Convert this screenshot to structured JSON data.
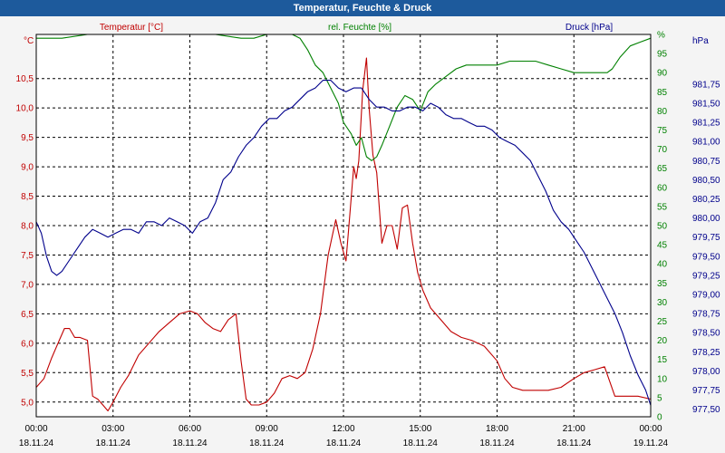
{
  "window": {
    "title": "Temperatur, Feuchte & Druck"
  },
  "chart_data": {
    "type": "line",
    "title": "Temperatur, Feuchte & Druck",
    "grid": true,
    "x_ticks": [
      {
        "h": 0,
        "time": "00:00",
        "date": "18.11.24"
      },
      {
        "h": 3,
        "time": "03:00",
        "date": "18.11.24"
      },
      {
        "h": 6,
        "time": "06:00",
        "date": "18.11.24"
      },
      {
        "h": 9,
        "time": "09:00",
        "date": "18.11.24"
      },
      {
        "h": 12,
        "time": "12:00",
        "date": "18.11.24"
      },
      {
        "h": 15,
        "time": "15:00",
        "date": "18.11.24"
      },
      {
        "h": 18,
        "time": "18:00",
        "date": "18.11.24"
      },
      {
        "h": 21,
        "time": "21:00",
        "date": "18.11.24"
      },
      {
        "h": 24,
        "time": "00:00",
        "date": "19.11.24"
      }
    ],
    "axes": {
      "temperature": {
        "label": "Temperatur [°C]",
        "unit": "°C",
        "color": "#c00000",
        "ylim": [
          4.75,
          11.25
        ],
        "ticks": [
          5.0,
          5.5,
          6.0,
          6.5,
          7.0,
          7.5,
          8.0,
          8.5,
          9.0,
          9.5,
          10.0,
          10.5
        ],
        "tick_labels": [
          "5,0",
          "5,5",
          "6,0",
          "6,5",
          "7,0",
          "7,5",
          "8,0",
          "8,5",
          "9,0",
          "9,5",
          "10,0",
          "10,5"
        ]
      },
      "humidity": {
        "label": "rel. Feuchte [%]",
        "unit": "%",
        "color": "#008000",
        "ylim": [
          0,
          100
        ],
        "ticks": [
          0,
          5,
          10,
          15,
          20,
          25,
          30,
          35,
          40,
          45,
          50,
          55,
          60,
          65,
          70,
          75,
          80,
          85,
          90,
          95,
          100
        ],
        "tick_labels": [
          "0",
          "5",
          "10",
          "15",
          "20",
          "25",
          "30",
          "35",
          "40",
          "45",
          "50",
          "55",
          "60",
          "65",
          "70",
          "75",
          "80",
          "85",
          "90",
          "95",
          "%"
        ]
      },
      "pressure": {
        "label": "Druck [hPa]",
        "unit": "hPa",
        "color": "#00008b",
        "ylim": [
          977.4,
          982.4
        ],
        "ticks": [
          977.5,
          977.75,
          978.0,
          978.25,
          978.5,
          978.75,
          979.0,
          979.25,
          979.5,
          979.75,
          980.0,
          980.25,
          980.5,
          980.75,
          981.0,
          981.25,
          981.5,
          981.75
        ],
        "tick_labels": [
          "977,50",
          "977,75",
          "978,00",
          "978,25",
          "978,50",
          "978,75",
          "979,00",
          "979,25",
          "979,50",
          "979,75",
          "980,00",
          "980,25",
          "980,50",
          "980,75",
          "981,00",
          "981,25",
          "981,50",
          "981,75"
        ]
      }
    },
    "series": [
      {
        "name": "Temperatur [°C]",
        "axis": "temperature",
        "color": "#c00000",
        "x": [
          0,
          0.3,
          0.6,
          0.9,
          1.1,
          1.3,
          1.5,
          1.7,
          2.0,
          2.2,
          2.4,
          2.6,
          2.8,
          3.0,
          3.3,
          3.6,
          4.0,
          4.4,
          4.8,
          5.2,
          5.6,
          6.0,
          6.3,
          6.6,
          6.9,
          7.2,
          7.5,
          7.8,
          8.0,
          8.2,
          8.4,
          8.7,
          9.0,
          9.3,
          9.6,
          9.9,
          10.2,
          10.5,
          10.8,
          11.1,
          11.4,
          11.7,
          11.9,
          12.1,
          12.25,
          12.4,
          12.5,
          12.6,
          12.75,
          12.9,
          13.0,
          13.15,
          13.3,
          13.5,
          13.7,
          13.9,
          14.1,
          14.3,
          14.5,
          14.7,
          14.9,
          15.1,
          15.4,
          15.8,
          16.2,
          16.6,
          17.0,
          17.5,
          18.0,
          18.3,
          18.6,
          19.0,
          19.5,
          20.0,
          20.5,
          21.0,
          21.4,
          21.8,
          22.2,
          22.6,
          23.0,
          23.5,
          24.0
        ],
        "values": [
          5.25,
          5.4,
          5.75,
          6.05,
          6.25,
          6.25,
          6.1,
          6.1,
          6.05,
          5.1,
          5.05,
          4.95,
          4.85,
          5.0,
          5.25,
          5.45,
          5.8,
          6.0,
          6.2,
          6.35,
          6.5,
          6.55,
          6.5,
          6.35,
          6.25,
          6.2,
          6.4,
          6.5,
          5.7,
          5.05,
          4.95,
          4.95,
          5.0,
          5.15,
          5.4,
          5.45,
          5.4,
          5.5,
          5.9,
          6.5,
          7.5,
          8.1,
          7.7,
          7.4,
          8.2,
          9.0,
          8.8,
          9.1,
          10.3,
          10.85,
          10.0,
          9.2,
          8.9,
          7.7,
          8.0,
          8.0,
          7.6,
          8.3,
          8.35,
          7.7,
          7.2,
          6.9,
          6.6,
          6.4,
          6.2,
          6.1,
          6.05,
          5.95,
          5.7,
          5.4,
          5.25,
          5.2,
          5.2,
          5.2,
          5.25,
          5.4,
          5.5,
          5.55,
          5.6,
          5.1,
          5.1,
          5.1,
          5.05
        ]
      },
      {
        "name": "rel. Feuchte [%]",
        "axis": "humidity",
        "color": "#008000",
        "x": [
          0,
          1,
          2,
          3,
          4,
          5,
          6,
          7,
          8,
          8.5,
          9,
          9.5,
          10,
          10.3,
          10.6,
          10.9,
          11.2,
          11.5,
          11.8,
          12.0,
          12.3,
          12.5,
          12.7,
          12.9,
          13.1,
          13.3,
          13.5,
          13.8,
          14.1,
          14.4,
          14.7,
          15.0,
          15.3,
          15.6,
          16.0,
          16.4,
          16.8,
          17.2,
          17.6,
          18.0,
          18.5,
          19.0,
          19.5,
          20.0,
          20.5,
          21.0,
          21.5,
          22.0,
          22.3,
          22.5,
          22.8,
          23.2,
          23.6,
          24.0
        ],
        "values": [
          99,
          99,
          100,
          100,
          100,
          100,
          100,
          100,
          99,
          99,
          100,
          100,
          100,
          99,
          96,
          92,
          90,
          86,
          82,
          77,
          74,
          71,
          73,
          68,
          67,
          68,
          71,
          76,
          81,
          84,
          83,
          80,
          85,
          87,
          89,
          91,
          92,
          92,
          92,
          92,
          93,
          93,
          93,
          92,
          91,
          90,
          90,
          90,
          90,
          91,
          94,
          97,
          98,
          99
        ]
      },
      {
        "name": "Druck [hPa]",
        "axis": "pressure",
        "color": "#00008b",
        "x": [
          0,
          0.2,
          0.4,
          0.6,
          0.8,
          1.0,
          1.3,
          1.6,
          1.9,
          2.2,
          2.5,
          2.8,
          3.1,
          3.4,
          3.7,
          4.0,
          4.3,
          4.6,
          4.9,
          5.2,
          5.5,
          5.8,
          6.1,
          6.4,
          6.7,
          7.0,
          7.3,
          7.6,
          7.9,
          8.2,
          8.5,
          8.8,
          9.1,
          9.4,
          9.7,
          10.0,
          10.3,
          10.6,
          10.9,
          11.2,
          11.5,
          11.8,
          12.1,
          12.4,
          12.7,
          13.0,
          13.3,
          13.6,
          13.9,
          14.2,
          14.5,
          14.8,
          15.1,
          15.4,
          15.7,
          16.0,
          16.3,
          16.6,
          16.9,
          17.2,
          17.5,
          17.8,
          18.1,
          18.4,
          18.7,
          19.0,
          19.3,
          19.6,
          19.9,
          20.2,
          20.5,
          20.8,
          21.1,
          21.4,
          21.7,
          22.0,
          22.3,
          22.6,
          22.9,
          23.2,
          23.5,
          23.8,
          24.0
        ],
        "values": [
          979.95,
          979.8,
          979.5,
          979.3,
          979.25,
          979.3,
          979.45,
          979.6,
          979.75,
          979.85,
          979.8,
          979.75,
          979.8,
          979.85,
          979.85,
          979.8,
          979.95,
          979.95,
          979.9,
          980.0,
          979.95,
          979.9,
          979.8,
          979.95,
          980.0,
          980.2,
          980.5,
          980.6,
          980.8,
          980.95,
          981.05,
          981.2,
          981.3,
          981.3,
          981.4,
          981.45,
          981.55,
          981.65,
          981.7,
          981.8,
          981.8,
          981.7,
          981.65,
          981.7,
          981.7,
          981.55,
          981.45,
          981.45,
          981.4,
          981.4,
          981.45,
          981.45,
          981.4,
          981.5,
          981.45,
          981.35,
          981.3,
          981.3,
          981.25,
          981.2,
          981.2,
          981.15,
          981.05,
          981.0,
          980.95,
          980.85,
          980.75,
          980.55,
          980.35,
          980.1,
          979.95,
          979.85,
          979.7,
          979.55,
          979.35,
          979.15,
          978.95,
          978.75,
          978.5,
          978.2,
          977.95,
          977.75,
          977.55
        ]
      }
    ]
  }
}
